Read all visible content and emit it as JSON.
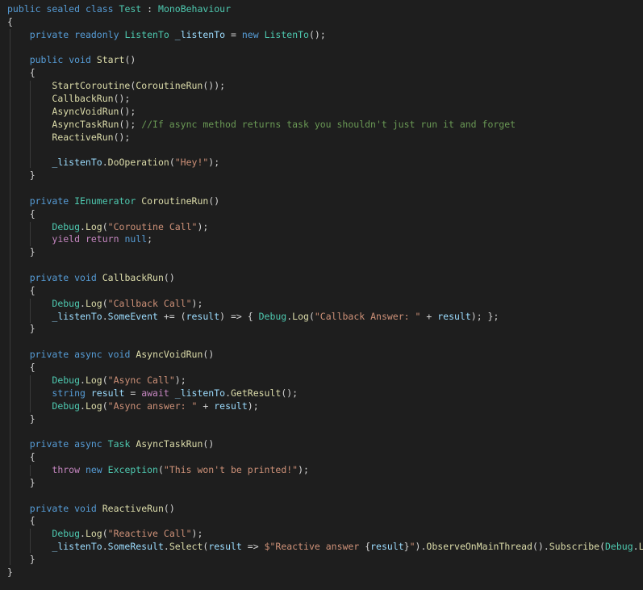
{
  "colors": {
    "background": "#1e1e1e",
    "kw": "#569cd6",
    "ctrl": "#c586c0",
    "type": "#4ec9b0",
    "fn": "#dcdcaa",
    "var": "#9cdcfe",
    "str": "#ce9178",
    "comment": "#6a9955",
    "plain": "#d4d4d4"
  },
  "editor": {
    "lines": [
      [
        [
          "kw",
          "public"
        ],
        [
          "plain",
          " "
        ],
        [
          "kw",
          "sealed"
        ],
        [
          "plain",
          " "
        ],
        [
          "kw",
          "class"
        ],
        [
          "plain",
          " "
        ],
        [
          "type",
          "Test"
        ],
        [
          "plain",
          " : "
        ],
        [
          "type",
          "MonoBehaviour"
        ]
      ],
      [
        [
          "plain",
          "{"
        ]
      ],
      [
        [
          "plain",
          "    "
        ],
        [
          "kw",
          "private"
        ],
        [
          "plain",
          " "
        ],
        [
          "kw",
          "readonly"
        ],
        [
          "plain",
          " "
        ],
        [
          "type",
          "ListenTo"
        ],
        [
          "plain",
          " "
        ],
        [
          "var",
          "_listenTo"
        ],
        [
          "plain",
          " = "
        ],
        [
          "kw",
          "new"
        ],
        [
          "plain",
          " "
        ],
        [
          "type",
          "ListenTo"
        ],
        [
          "plain",
          "();"
        ]
      ],
      [],
      [
        [
          "plain",
          "    "
        ],
        [
          "kw",
          "public"
        ],
        [
          "plain",
          " "
        ],
        [
          "kw",
          "void"
        ],
        [
          "plain",
          " "
        ],
        [
          "fn",
          "Start"
        ],
        [
          "plain",
          "()"
        ]
      ],
      [
        [
          "plain",
          "    {"
        ]
      ],
      [
        [
          "plain",
          "        "
        ],
        [
          "fn",
          "StartCoroutine"
        ],
        [
          "plain",
          "("
        ],
        [
          "fn",
          "CoroutineRun"
        ],
        [
          "plain",
          "());"
        ]
      ],
      [
        [
          "plain",
          "        "
        ],
        [
          "fn",
          "CallbackRun"
        ],
        [
          "plain",
          "();"
        ]
      ],
      [
        [
          "plain",
          "        "
        ],
        [
          "fn",
          "AsyncVoidRun"
        ],
        [
          "plain",
          "();"
        ]
      ],
      [
        [
          "plain",
          "        "
        ],
        [
          "fn",
          "AsyncTaskRun"
        ],
        [
          "plain",
          "(); "
        ],
        [
          "comment",
          "//If async method returns task you shouldn't just run it and forget"
        ]
      ],
      [
        [
          "plain",
          "        "
        ],
        [
          "fn",
          "ReactiveRun"
        ],
        [
          "plain",
          "();"
        ]
      ],
      [],
      [
        [
          "plain",
          "        "
        ],
        [
          "var",
          "_listenTo"
        ],
        [
          "plain",
          "."
        ],
        [
          "fn",
          "DoOperation"
        ],
        [
          "plain",
          "("
        ],
        [
          "str",
          "\"Hey!\""
        ],
        [
          "plain",
          ");"
        ]
      ],
      [
        [
          "plain",
          "    }"
        ]
      ],
      [],
      [
        [
          "plain",
          "    "
        ],
        [
          "kw",
          "private"
        ],
        [
          "plain",
          " "
        ],
        [
          "type",
          "IEnumerator"
        ],
        [
          "plain",
          " "
        ],
        [
          "fn",
          "CoroutineRun"
        ],
        [
          "plain",
          "()"
        ]
      ],
      [
        [
          "plain",
          "    {"
        ]
      ],
      [
        [
          "plain",
          "        "
        ],
        [
          "type",
          "Debug"
        ],
        [
          "plain",
          "."
        ],
        [
          "fn",
          "Log"
        ],
        [
          "plain",
          "("
        ],
        [
          "str",
          "\"Coroutine Call\""
        ],
        [
          "plain",
          ");"
        ]
      ],
      [
        [
          "plain",
          "        "
        ],
        [
          "ctrl",
          "yield"
        ],
        [
          "plain",
          " "
        ],
        [
          "ctrl",
          "return"
        ],
        [
          "plain",
          " "
        ],
        [
          "kw",
          "null"
        ],
        [
          "plain",
          ";"
        ]
      ],
      [
        [
          "plain",
          "    }"
        ]
      ],
      [],
      [
        [
          "plain",
          "    "
        ],
        [
          "kw",
          "private"
        ],
        [
          "plain",
          " "
        ],
        [
          "kw",
          "void"
        ],
        [
          "plain",
          " "
        ],
        [
          "fn",
          "CallbackRun"
        ],
        [
          "plain",
          "()"
        ]
      ],
      [
        [
          "plain",
          "    {"
        ]
      ],
      [
        [
          "plain",
          "        "
        ],
        [
          "type",
          "Debug"
        ],
        [
          "plain",
          "."
        ],
        [
          "fn",
          "Log"
        ],
        [
          "plain",
          "("
        ],
        [
          "str",
          "\"Callback Call\""
        ],
        [
          "plain",
          ");"
        ]
      ],
      [
        [
          "plain",
          "        "
        ],
        [
          "var",
          "_listenTo"
        ],
        [
          "plain",
          "."
        ],
        [
          "var",
          "SomeEvent"
        ],
        [
          "plain",
          " += ("
        ],
        [
          "var",
          "result"
        ],
        [
          "plain",
          ") => { "
        ],
        [
          "type",
          "Debug"
        ],
        [
          "plain",
          "."
        ],
        [
          "fn",
          "Log"
        ],
        [
          "plain",
          "("
        ],
        [
          "str",
          "\"Callback Answer: \""
        ],
        [
          "plain",
          " + "
        ],
        [
          "var",
          "result"
        ],
        [
          "plain",
          "); };"
        ]
      ],
      [
        [
          "plain",
          "    }"
        ]
      ],
      [],
      [
        [
          "plain",
          "    "
        ],
        [
          "kw",
          "private"
        ],
        [
          "plain",
          " "
        ],
        [
          "kw",
          "async"
        ],
        [
          "plain",
          " "
        ],
        [
          "kw",
          "void"
        ],
        [
          "plain",
          " "
        ],
        [
          "fn",
          "AsyncVoidRun"
        ],
        [
          "plain",
          "()"
        ]
      ],
      [
        [
          "plain",
          "    {"
        ]
      ],
      [
        [
          "plain",
          "        "
        ],
        [
          "type",
          "Debug"
        ],
        [
          "plain",
          "."
        ],
        [
          "fn",
          "Log"
        ],
        [
          "plain",
          "("
        ],
        [
          "str",
          "\"Async Call\""
        ],
        [
          "plain",
          ");"
        ]
      ],
      [
        [
          "plain",
          "        "
        ],
        [
          "kw",
          "string"
        ],
        [
          "plain",
          " "
        ],
        [
          "var",
          "result"
        ],
        [
          "plain",
          " = "
        ],
        [
          "ctrl",
          "await"
        ],
        [
          "plain",
          " "
        ],
        [
          "var",
          "_listenTo"
        ],
        [
          "plain",
          "."
        ],
        [
          "fn",
          "GetResult"
        ],
        [
          "plain",
          "();"
        ]
      ],
      [
        [
          "plain",
          "        "
        ],
        [
          "type",
          "Debug"
        ],
        [
          "plain",
          "."
        ],
        [
          "fn",
          "Log"
        ],
        [
          "plain",
          "("
        ],
        [
          "str",
          "\"Async answer: \""
        ],
        [
          "plain",
          " + "
        ],
        [
          "var",
          "result"
        ],
        [
          "plain",
          ");"
        ]
      ],
      [
        [
          "plain",
          "    }"
        ]
      ],
      [],
      [
        [
          "plain",
          "    "
        ],
        [
          "kw",
          "private"
        ],
        [
          "plain",
          " "
        ],
        [
          "kw",
          "async"
        ],
        [
          "plain",
          " "
        ],
        [
          "type",
          "Task"
        ],
        [
          "plain",
          " "
        ],
        [
          "fn",
          "AsyncTaskRun"
        ],
        [
          "plain",
          "()"
        ]
      ],
      [
        [
          "plain",
          "    {"
        ]
      ],
      [
        [
          "plain",
          "        "
        ],
        [
          "ctrl",
          "throw"
        ],
        [
          "plain",
          " "
        ],
        [
          "kw",
          "new"
        ],
        [
          "plain",
          " "
        ],
        [
          "type",
          "Exception"
        ],
        [
          "plain",
          "("
        ],
        [
          "str",
          "\"This won't be printed!\""
        ],
        [
          "plain",
          ");"
        ]
      ],
      [
        [
          "plain",
          "    }"
        ]
      ],
      [],
      [
        [
          "plain",
          "    "
        ],
        [
          "kw",
          "private"
        ],
        [
          "plain",
          " "
        ],
        [
          "kw",
          "void"
        ],
        [
          "plain",
          " "
        ],
        [
          "fn",
          "ReactiveRun"
        ],
        [
          "plain",
          "()"
        ]
      ],
      [
        [
          "plain",
          "    {"
        ]
      ],
      [
        [
          "plain",
          "        "
        ],
        [
          "type",
          "Debug"
        ],
        [
          "plain",
          "."
        ],
        [
          "fn",
          "Log"
        ],
        [
          "plain",
          "("
        ],
        [
          "str",
          "\"Reactive Call\""
        ],
        [
          "plain",
          ");"
        ]
      ],
      [
        [
          "plain",
          "        "
        ],
        [
          "var",
          "_listenTo"
        ],
        [
          "plain",
          "."
        ],
        [
          "var",
          "SomeResult"
        ],
        [
          "plain",
          "."
        ],
        [
          "fn",
          "Select"
        ],
        [
          "plain",
          "("
        ],
        [
          "var",
          "result"
        ],
        [
          "plain",
          " => "
        ],
        [
          "str",
          "$\"Reactive answer "
        ],
        [
          "plain",
          "{"
        ],
        [
          "var",
          "result"
        ],
        [
          "plain",
          "}"
        ],
        [
          "str",
          "\""
        ],
        [
          "plain",
          ")."
        ],
        [
          "fn",
          "ObserveOnMainThread"
        ],
        [
          "plain",
          "()."
        ],
        [
          "fn",
          "Subscribe"
        ],
        [
          "plain",
          "("
        ],
        [
          "type",
          "Debug"
        ],
        [
          "plain",
          "."
        ],
        [
          "fn",
          "Log"
        ],
        [
          "plain",
          ");"
        ]
      ],
      [
        [
          "plain",
          "    }"
        ]
      ],
      [
        [
          "plain",
          "}"
        ]
      ]
    ]
  }
}
